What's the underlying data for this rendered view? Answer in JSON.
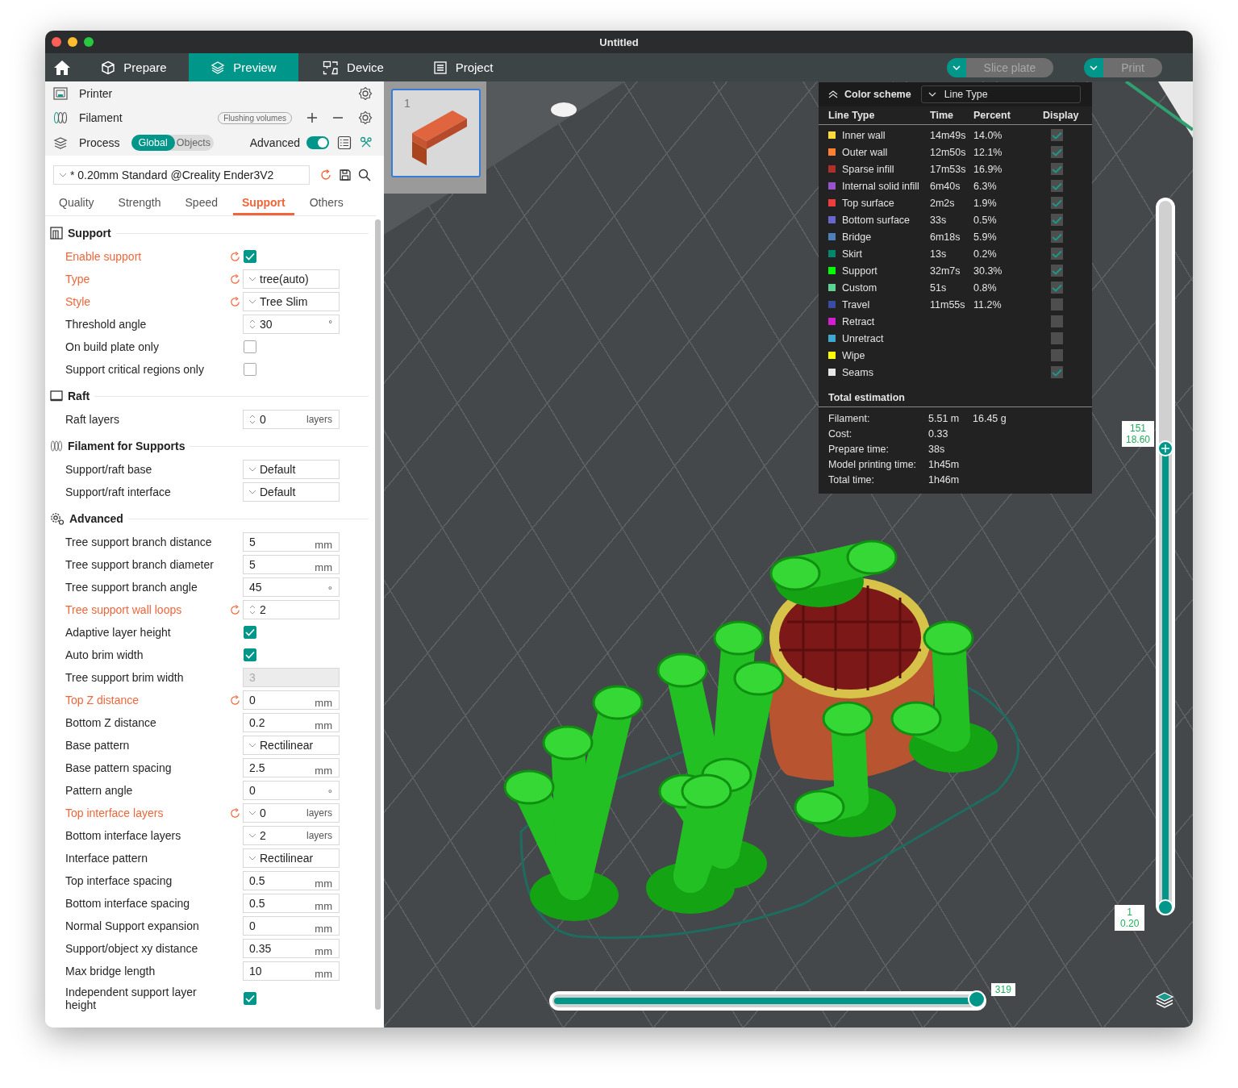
{
  "window": {
    "title": "Untitled"
  },
  "nav": {
    "tabs": [
      {
        "label": "Prepare",
        "selected": false
      },
      {
        "label": "Preview",
        "selected": true
      },
      {
        "label": "Device",
        "selected": false
      },
      {
        "label": "Project",
        "selected": false
      }
    ],
    "actions": [
      {
        "label": "Slice plate",
        "disabled": true
      },
      {
        "label": "Print",
        "disabled": true
      }
    ]
  },
  "sidebar": {
    "printer": "Printer",
    "filament": "Filament",
    "flushing_button": "Flushing volumes",
    "process": "Process",
    "modes": [
      {
        "label": "Global",
        "selected": true
      },
      {
        "label": "Objects",
        "selected": false
      }
    ],
    "advanced": {
      "label": "Advanced",
      "on": true
    },
    "preset": "* 0.20mm Standard @Creality Ender3V2",
    "tabs": [
      {
        "label": "Quality",
        "selected": false
      },
      {
        "label": "Strength",
        "selected": false
      },
      {
        "label": "Speed",
        "selected": false
      },
      {
        "label": "Support",
        "selected": true
      },
      {
        "label": "Others",
        "selected": false
      }
    ],
    "sections": [
      {
        "title": "Support",
        "rows": [
          {
            "label": "Enable support",
            "modified": true,
            "kind": "checkbox",
            "checked": true
          },
          {
            "label": "Type",
            "modified": true,
            "kind": "select",
            "value": "tree(auto)"
          },
          {
            "label": "Style",
            "modified": true,
            "kind": "select",
            "value": "Tree Slim"
          },
          {
            "label": "Threshold angle",
            "modified": false,
            "kind": "spin",
            "value": "30",
            "unit": "°"
          },
          {
            "label": "On build plate only",
            "modified": false,
            "kind": "checkbox",
            "checked": false
          },
          {
            "label": "Support critical regions only",
            "modified": false,
            "kind": "checkbox",
            "checked": false
          }
        ]
      },
      {
        "title": "Raft",
        "rows": [
          {
            "label": "Raft layers",
            "modified": false,
            "kind": "spin",
            "value": "0",
            "unit": "layers"
          }
        ]
      },
      {
        "title": "Filament for Supports",
        "rows": [
          {
            "label": "Support/raft base",
            "modified": false,
            "kind": "select",
            "value": "Default"
          },
          {
            "label": "Support/raft interface",
            "modified": false,
            "kind": "select",
            "value": "Default"
          }
        ]
      },
      {
        "title": "Advanced",
        "rows": [
          {
            "label": "Tree support branch distance",
            "modified": false,
            "kind": "input",
            "value": "5",
            "unit": "mm"
          },
          {
            "label": "Tree support branch diameter",
            "modified": false,
            "kind": "input",
            "value": "5",
            "unit": "mm"
          },
          {
            "label": "Tree support branch angle",
            "modified": false,
            "kind": "input",
            "value": "45",
            "unit": "°"
          },
          {
            "label": "Tree support wall loops",
            "modified": true,
            "kind": "spin",
            "value": "2"
          },
          {
            "label": "Adaptive layer height",
            "modified": false,
            "kind": "checkbox",
            "checked": true
          },
          {
            "label": "Auto brim width",
            "modified": false,
            "kind": "checkbox",
            "checked": true
          },
          {
            "label": "Tree support brim width",
            "modified": false,
            "kind": "input",
            "value": "3",
            "disabled": true
          },
          {
            "label": "Top Z distance",
            "modified": true,
            "kind": "input",
            "value": "0",
            "unit": "mm"
          },
          {
            "label": "Bottom Z distance",
            "modified": false,
            "kind": "input",
            "value": "0.2",
            "unit": "mm"
          },
          {
            "label": "Base pattern",
            "modified": false,
            "kind": "select",
            "value": "Rectilinear"
          },
          {
            "label": "Base pattern spacing",
            "modified": false,
            "kind": "input",
            "value": "2.5",
            "unit": "mm"
          },
          {
            "label": "Pattern angle",
            "modified": false,
            "kind": "input",
            "value": "0",
            "unit": "°"
          },
          {
            "label": "Top interface layers",
            "modified": true,
            "kind": "select",
            "value": "0",
            "unit": "layers"
          },
          {
            "label": "Bottom interface layers",
            "modified": false,
            "kind": "select",
            "value": "2",
            "unit": "layers"
          },
          {
            "label": "Interface pattern",
            "modified": false,
            "kind": "select",
            "value": "Rectilinear"
          },
          {
            "label": "Top interface spacing",
            "modified": false,
            "kind": "input",
            "value": "0.5",
            "unit": "mm"
          },
          {
            "label": "Bottom interface spacing",
            "modified": false,
            "kind": "input",
            "value": "0.5",
            "unit": "mm"
          },
          {
            "label": "Normal Support expansion",
            "modified": false,
            "kind": "input",
            "value": "0",
            "unit": "mm"
          },
          {
            "label": "Support/object xy distance",
            "modified": false,
            "kind": "input",
            "value": "0.35",
            "unit": "mm"
          },
          {
            "label": "Max bridge length",
            "modified": false,
            "kind": "input",
            "value": "10",
            "unit": "mm"
          },
          {
            "label": "Independent support layer height",
            "modified": false,
            "kind": "checkbox",
            "checked": true
          }
        ]
      }
    ]
  },
  "viewport": {
    "plate_number": "1",
    "legend": {
      "title": "Color scheme",
      "scheme": "Line Type",
      "columns": [
        "Line Type",
        "Time",
        "Percent",
        "Display"
      ],
      "items": [
        {
          "name": "Inner wall",
          "color": "#ffd83a",
          "time": "14m49s",
          "percent": "14.0%",
          "display": true
        },
        {
          "name": "Outer wall",
          "color": "#ff7f33",
          "time": "12m50s",
          "percent": "12.1%",
          "display": true
        },
        {
          "name": "Sparse infill",
          "color": "#b03029",
          "time": "17m53s",
          "percent": "16.9%",
          "display": true
        },
        {
          "name": "Internal solid infill",
          "color": "#9654cc",
          "time": "6m40s",
          "percent": "6.3%",
          "display": true
        },
        {
          "name": "Top surface",
          "color": "#f03c3c",
          "time": "2m2s",
          "percent": "1.9%",
          "display": true
        },
        {
          "name": "Bottom surface",
          "color": "#6666cc",
          "time": "33s",
          "percent": "0.5%",
          "display": true
        },
        {
          "name": "Bridge",
          "color": "#4d80ba",
          "time": "6m18s",
          "percent": "5.9%",
          "display": true
        },
        {
          "name": "Skirt",
          "color": "#00876e",
          "time": "13s",
          "percent": "0.2%",
          "display": true
        },
        {
          "name": "Support",
          "color": "#00ff00",
          "time": "32m7s",
          "percent": "30.3%",
          "display": true
        },
        {
          "name": "Custom",
          "color": "#5ed194",
          "time": "51s",
          "percent": "0.8%",
          "display": true
        },
        {
          "name": "Travel",
          "color": "#384ca3",
          "time": "11m55s",
          "percent": "11.2%",
          "display": false
        },
        {
          "name": "Retract",
          "color": "#d11fd1",
          "display": false
        },
        {
          "name": "Unretract",
          "color": "#3fa8d1",
          "display": false
        },
        {
          "name": "Wipe",
          "color": "#ffff00",
          "display": false
        },
        {
          "name": "Seams",
          "color": "#e6e6e6",
          "display": true
        }
      ],
      "total_title": "Total estimation",
      "totals": [
        {
          "label": "Filament:",
          "values": [
            "5.51 m",
            "16.45 g"
          ]
        },
        {
          "label": "Cost:",
          "values": [
            "0.33"
          ]
        },
        {
          "label": "Prepare time:",
          "values": [
            "38s"
          ]
        },
        {
          "label": "Model printing time:",
          "values": [
            "1h45m"
          ]
        },
        {
          "label": "Total time:",
          "values": [
            "1h46m"
          ]
        }
      ]
    },
    "layer_slider": {
      "level": 0.653,
      "upper": [
        "151",
        "18.60"
      ],
      "lower": [
        "1",
        "0.20"
      ]
    },
    "move_slider": {
      "level": 0.985,
      "reading": "319"
    }
  }
}
